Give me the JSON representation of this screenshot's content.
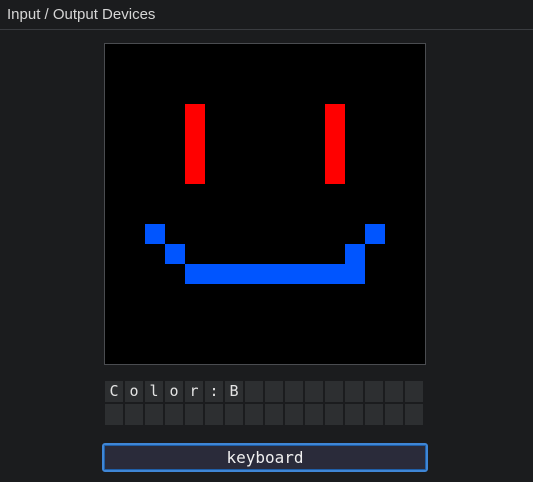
{
  "panel": {
    "title": "Input / Output Devices"
  },
  "display": {
    "grid_size": 16,
    "background": "#000000",
    "colors": {
      "R": "#ff0000",
      "B": "#0055ff"
    },
    "rows": [
      "................",
      "................",
      "................",
      "....R......R....",
      "....R......R....",
      "....R......R....",
      "....R......R....",
      "................",
      "................",
      "..B..........B..",
      "...B........B...",
      "....BBBBBBBBB...",
      "................",
      "................",
      "................",
      "................"
    ]
  },
  "char_display": {
    "rows": [
      [
        "C",
        "o",
        "l",
        "o",
        "r",
        ":",
        "B",
        "",
        "",
        "",
        "",
        "",
        "",
        "",
        "",
        ""
      ],
      [
        "",
        "",
        "",
        "",
        "",
        "",
        "",
        "",
        "",
        "",
        "",
        "",
        "",
        "",
        "",
        ""
      ]
    ]
  },
  "keyboard": {
    "value": "keyboard"
  }
}
